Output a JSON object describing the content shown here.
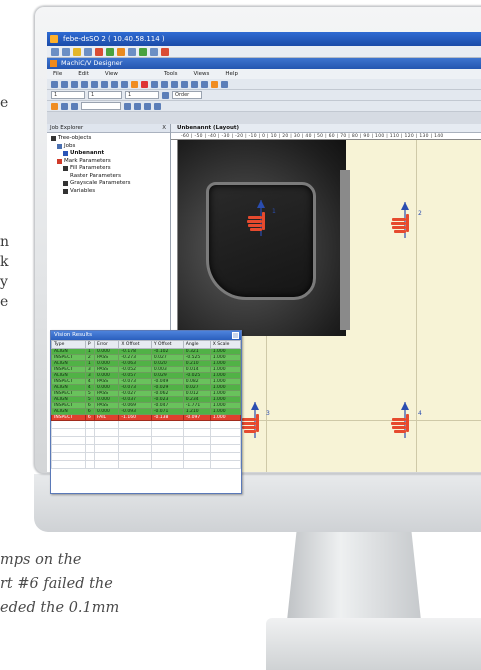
{
  "background_text": {
    "fragments": [
      "e",
      "n",
      "k",
      "y",
      "e"
    ],
    "caption_lines": [
      "mps on the",
      "rt #6 failed the",
      "eded the 0.1mm"
    ]
  },
  "app": {
    "window_title": "febe-dsSO 2 ( 10.40.58.114 )",
    "designer_title": "MachiC/V Designer",
    "menu": [
      "File",
      "Edit",
      "View",
      "Tools",
      "Views",
      "Help"
    ],
    "toolbar_fields": {
      "field1": "1",
      "field2": "1",
      "field3": "1",
      "order_label": "Order"
    }
  },
  "left_panel": {
    "header": "Job Explorer",
    "close": "X",
    "tree": [
      {
        "label": "Tree-objects",
        "icon": "folder-icon"
      },
      {
        "label": "Jobs",
        "icon": "jobs-icon"
      },
      {
        "label": "Unbenannt",
        "icon": "job-icon"
      },
      {
        "label": "Mark Parameters",
        "icon": "mark-icon"
      },
      {
        "label": "Fill Parameters",
        "icon": "fill-icon"
      },
      {
        "label": "Raster Parameters",
        "icon": "raster-icon"
      },
      {
        "label": "Grayscale Parameters",
        "icon": "grayscale-icon"
      },
      {
        "label": "Variables",
        "icon": "variables-icon"
      }
    ]
  },
  "document": {
    "tab_label": "Unbenannt (Layout)",
    "ruler_text": "-60 | -50 | -40 | -30 | -20 | -10 | 0 | 10 | 20 | 30 | 40 | 50 | 60 | 70 | 80 | 90 | 100 | 110 | 120 | 130 | 140",
    "tool_labels": [
      "1",
      "2",
      "3",
      "4"
    ]
  },
  "results": {
    "title": "Vision Results",
    "close": "x",
    "columns": [
      "Type",
      "P",
      "Error",
      "X Offset",
      "Y Offset",
      "Angle",
      "X Scale"
    ],
    "rows": [
      {
        "status": "pass",
        "cells": [
          "ALIGN",
          "1",
          "0.000",
          "-0.178",
          "-0.102",
          "0.321",
          "1.000"
        ]
      },
      {
        "status": "pass2",
        "cells": [
          "INSPECT",
          "2",
          "PASS",
          "-0.273",
          "0.027",
          "-0.525",
          "1.000"
        ]
      },
      {
        "status": "pass",
        "cells": [
          "ALIGN",
          "1",
          "0.000",
          "-0.063",
          "0.020",
          "0.210",
          "1.000"
        ]
      },
      {
        "status": "pass2",
        "cells": [
          "INSPECT",
          "3",
          "PASS",
          "-0.052",
          "0.003",
          "0.014",
          "1.000"
        ]
      },
      {
        "status": "pass",
        "cells": [
          "ALIGN",
          "3",
          "0.000",
          "-0.057",
          "0.029",
          "-0.025",
          "1.000"
        ]
      },
      {
        "status": "pass2",
        "cells": [
          "INSPECT",
          "4",
          "PASS",
          "-0.073",
          "-0.049",
          "0.082",
          "1.000"
        ]
      },
      {
        "status": "pass",
        "cells": [
          "ALIGN",
          "4",
          "0.000",
          "-0.073",
          "-0.029",
          "0.027",
          "1.000"
        ]
      },
      {
        "status": "pass2",
        "cells": [
          "INSPECT",
          "5",
          "PASS",
          "-0.027",
          "-0.062",
          "0.012",
          "1.000"
        ]
      },
      {
        "status": "pass",
        "cells": [
          "ALIGN",
          "5",
          "0.000",
          "-0.037",
          "-0.023",
          "0.234",
          "1.000"
        ]
      },
      {
        "status": "pass2",
        "cells": [
          "INSPECT",
          "6",
          "PASS",
          "-0.069",
          "-0.047",
          "-1.771",
          "1.000"
        ]
      },
      {
        "status": "pass",
        "cells": [
          "ALIGN",
          "6",
          "0.000",
          "-0.093",
          "-0.071",
          "1.210",
          "1.000"
        ]
      },
      {
        "status": "fail",
        "cells": [
          "INSPECT",
          "6",
          "FAIL",
          "-1.160",
          "-0.138",
          "-0.097",
          "1.000"
        ]
      }
    ]
  },
  "colors": {
    "pass": "#51b246",
    "fail": "#e0402e",
    "titlebar": "#2f6bd3",
    "canvas": "#f7f3d6"
  }
}
